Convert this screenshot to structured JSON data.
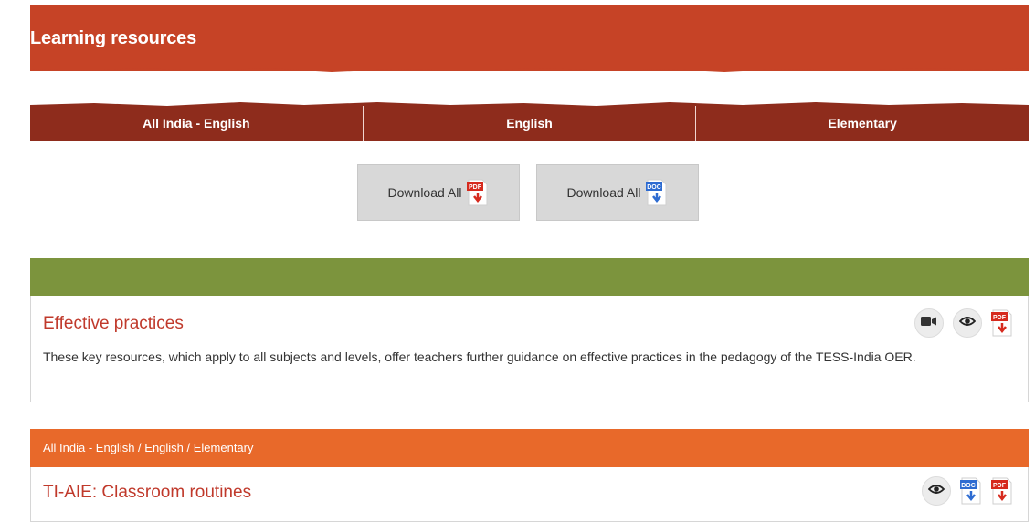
{
  "header": {
    "title": "Learning resources"
  },
  "filters": [
    {
      "label": "All India - English"
    },
    {
      "label": "English"
    },
    {
      "label": "Elementary"
    }
  ],
  "downloads": {
    "pdf_label": "Download All",
    "doc_label": "Download All",
    "pdf_icon": "pdf-icon",
    "doc_icon": "doc-icon"
  },
  "icons": {
    "pdf_badge": "PDF",
    "doc_badge": "DOC"
  },
  "resources": [
    {
      "title": "Effective practices",
      "description": "These key resources, which apply to all subjects and levels, offer teachers further guidance on effective practices in the pedagogy of the TESS-India OER.",
      "actions": [
        "video-icon",
        "eye-icon",
        "pdf-icon"
      ]
    },
    {
      "category": "All India - English / English / Elementary",
      "title": "TI-AIE: Classroom routines",
      "actions": [
        "eye-icon",
        "doc-icon",
        "pdf-icon"
      ]
    }
  ],
  "colors": {
    "banner": "#c64326",
    "filter_bar": "#8e2c1c",
    "green_bar": "#7c943d",
    "orange_bar": "#e8692a",
    "title_red": "#c0392b"
  }
}
